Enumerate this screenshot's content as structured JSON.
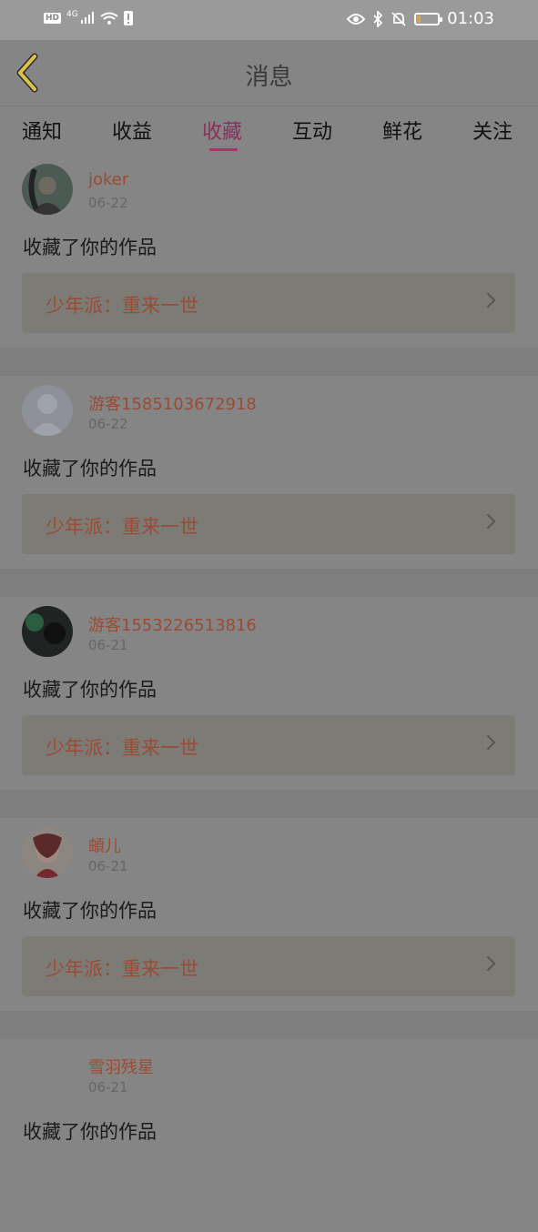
{
  "status_bar": {
    "hd": "HD",
    "network": "4G",
    "time": "01:03",
    "icons": [
      "hd-icon",
      "signal-icon",
      "wifi-icon",
      "alert-icon",
      "eye-icon",
      "bluetooth-icon",
      "mute-bell-icon",
      "battery-icon"
    ],
    "battery_level": 0.2,
    "battery_color": "#d9a25a"
  },
  "header": {
    "title": "消息",
    "back_icon": "chevron-left-icon",
    "back_color": "#d8c24a"
  },
  "tabs": [
    {
      "label": "通知"
    },
    {
      "label": "收益"
    },
    {
      "label": "收藏",
      "active": true
    },
    {
      "label": "互动"
    },
    {
      "label": "鲜花"
    },
    {
      "label": "关注"
    }
  ],
  "accent_color": "#b0306a",
  "items": [
    {
      "user": "joker",
      "date": "06-22",
      "message": "收藏了你的作品",
      "work": "少年派：重来一世",
      "avatar": "photo-avatar"
    },
    {
      "user": "游客1585103672918",
      "date": "06-22",
      "message": "收藏了你的作品",
      "work": "少年派：重来一世",
      "avatar": "default-avatar"
    },
    {
      "user": "游客1553226513816",
      "date": "06-21",
      "message": "收藏了你的作品",
      "work": "少年派：重来一世",
      "avatar": "photo-avatar"
    },
    {
      "user": "頔儿",
      "date": "06-21",
      "message": "收藏了你的作品",
      "work": "少年派：重来一世",
      "avatar": "illustration-avatar"
    },
    {
      "user": "雪羽残星",
      "date": "06-21",
      "message": "收藏了你的作品",
      "work": "",
      "avatar": "none"
    }
  ]
}
